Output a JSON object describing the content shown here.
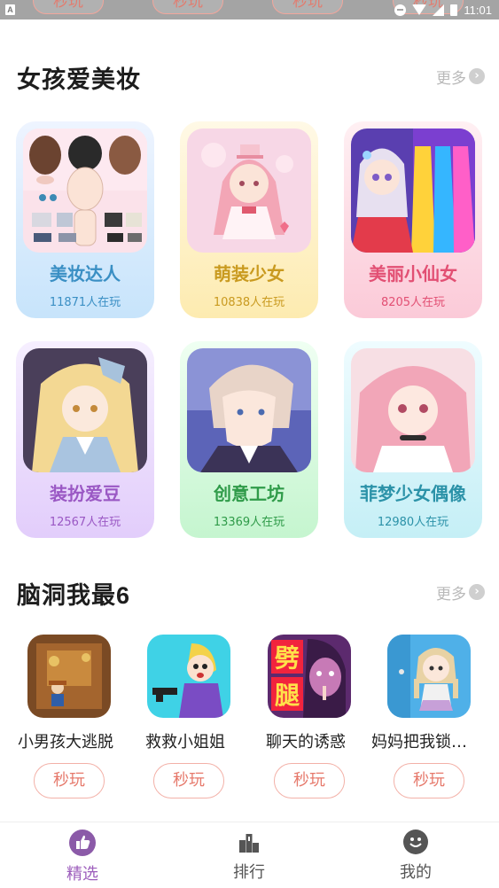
{
  "status_bar": {
    "time": "11:01",
    "partial_buttons": [
      "秒玩",
      "秒玩",
      "秒玩",
      "秒玩"
    ],
    "left_icon": "A"
  },
  "section1": {
    "title": "女孩爱美妆",
    "more": "更多",
    "cards": [
      {
        "name": "美妆达人",
        "plays": "11871人在玩",
        "color": "#3a8fc4"
      },
      {
        "name": "萌装少女",
        "plays": "10838人在玩",
        "color": "#c99a1f"
      },
      {
        "name": "美丽小仙女",
        "plays": "8205人在玩",
        "color": "#e24f73"
      },
      {
        "name": "装扮爱豆",
        "plays": "12567人在玩",
        "color": "#9a58c4"
      },
      {
        "name": "创意工坊",
        "plays": "13369人在玩",
        "color": "#2f9b49"
      },
      {
        "name": "菲梦少女偶像",
        "plays": "12980人在玩",
        "color": "#2b92a8"
      }
    ]
  },
  "section2": {
    "title": "脑洞我最6",
    "more": "更多",
    "games": [
      {
        "name": "小男孩大逃脱",
        "button": "秒玩"
      },
      {
        "name": "救救小姐姐",
        "button": "秒玩"
      },
      {
        "name": "聊天的诱惑",
        "button": "秒玩",
        "icon_text": [
          "劈",
          "腿"
        ]
      },
      {
        "name": "妈妈把我锁在家",
        "button": "秒玩"
      }
    ]
  },
  "bottom_nav": [
    {
      "label": "精选",
      "icon": "thumbs-up-icon",
      "active": true
    },
    {
      "label": "排行",
      "icon": "ranking-icon",
      "active": false
    },
    {
      "label": "我的",
      "icon": "smiley-icon",
      "active": false
    }
  ]
}
